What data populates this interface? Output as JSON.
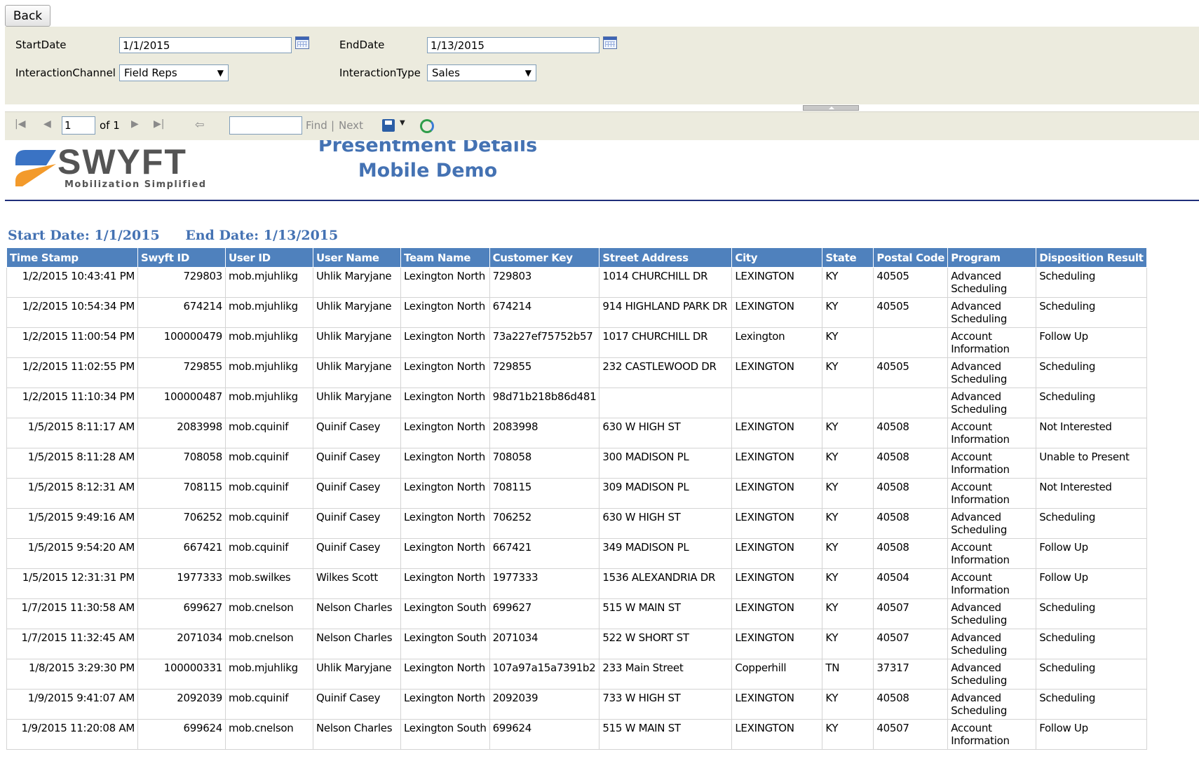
{
  "back_label": "Back",
  "params": {
    "start_date_label": "StartDate",
    "start_date_value": "1/1/2015",
    "end_date_label": "EndDate",
    "end_date_value": "1/13/2015",
    "channel_label": "InteractionChannel",
    "channel_value": "Field Reps",
    "type_label": "InteractionType",
    "type_value": "Sales"
  },
  "toolbar": {
    "page_value": "1",
    "of_label": "of 1",
    "find_label": "Find",
    "separator": "|",
    "next_label": "Next"
  },
  "logo": {
    "name": "SWYFT",
    "tagline": "Mobilization Simplified"
  },
  "report": {
    "title": "Presentment Details",
    "subtitle": "Mobile Demo",
    "start_date_text": "Start Date: 1/1/2015",
    "end_date_text": "End Date: 1/13/2015"
  },
  "table": {
    "columns": [
      "Time Stamp",
      "Swyft ID",
      "User ID",
      "User Name",
      "Team Name",
      "Customer Key",
      "Street Address",
      "City",
      "State",
      "Postal Code",
      "Program",
      "Disposition Result"
    ],
    "rows": [
      [
        "1/2/2015 10:43:41 PM",
        "729803",
        "mob.mjuhlikg",
        "Uhlik Maryjane",
        "Lexington North",
        "729803",
        "1014 CHURCHILL DR",
        "LEXINGTON",
        "KY",
        "40505",
        "Advanced Scheduling",
        "Scheduling"
      ],
      [
        "1/2/2015 10:54:34 PM",
        "674214",
        "mob.mjuhlikg",
        "Uhlik Maryjane",
        "Lexington North",
        "674214",
        "914 HIGHLAND PARK DR",
        "LEXINGTON",
        "KY",
        "40505",
        "Advanced Scheduling",
        "Scheduling"
      ],
      [
        "1/2/2015 11:00:54 PM",
        "100000479",
        "mob.mjuhlikg",
        "Uhlik Maryjane",
        "Lexington North",
        "73a227ef75752b57",
        "1017 CHURCHILL DR",
        "Lexington",
        "KY",
        "",
        "Account Information",
        "Follow Up"
      ],
      [
        "1/2/2015 11:02:55 PM",
        "729855",
        "mob.mjuhlikg",
        "Uhlik Maryjane",
        "Lexington North",
        "729855",
        "232 CASTLEWOOD DR",
        "LEXINGTON",
        "KY",
        "40505",
        "Advanced Scheduling",
        "Scheduling"
      ],
      [
        "1/2/2015 11:10:34 PM",
        "100000487",
        "mob.mjuhlikg",
        "Uhlik Maryjane",
        "Lexington North",
        "98d71b218b86d481",
        "",
        "",
        "",
        "",
        "Advanced Scheduling",
        "Scheduling"
      ],
      [
        "1/5/2015 8:11:17 AM",
        "2083998",
        "mob.cquinif",
        "Quinif Casey",
        "Lexington North",
        "2083998",
        "630 W HIGH ST",
        "LEXINGTON",
        "KY",
        "40508",
        "Account Information",
        "Not Interested"
      ],
      [
        "1/5/2015 8:11:28 AM",
        "708058",
        "mob.cquinif",
        "Quinif Casey",
        "Lexington North",
        "708058",
        "300 MADISON PL",
        "LEXINGTON",
        "KY",
        "40508",
        "Account Information",
        "Unable to Present"
      ],
      [
        "1/5/2015 8:12:31 AM",
        "708115",
        "mob.cquinif",
        "Quinif Casey",
        "Lexington North",
        "708115",
        "309 MADISON PL",
        "LEXINGTON",
        "KY",
        "40508",
        "Account Information",
        "Not Interested"
      ],
      [
        "1/5/2015 9:49:16 AM",
        "706252",
        "mob.cquinif",
        "Quinif Casey",
        "Lexington North",
        "706252",
        "630 W HIGH ST",
        "LEXINGTON",
        "KY",
        "40508",
        "Advanced Scheduling",
        "Scheduling"
      ],
      [
        "1/5/2015 9:54:20 AM",
        "667421",
        "mob.cquinif",
        "Quinif Casey",
        "Lexington North",
        "667421",
        "349 MADISON PL",
        "LEXINGTON",
        "KY",
        "40508",
        "Account Information",
        "Follow Up"
      ],
      [
        "1/5/2015 12:31:31 PM",
        "1977333",
        "mob.swilkes",
        "Wilkes Scott",
        "Lexington North",
        "1977333",
        "1536 ALEXANDRIA DR",
        "LEXINGTON",
        "KY",
        "40504",
        "Account Information",
        "Follow Up"
      ],
      [
        "1/7/2015 11:30:58 AM",
        "699627",
        "mob.cnelson",
        "Nelson Charles",
        "Lexington South",
        "699627",
        "515 W MAIN ST",
        "LEXINGTON",
        "KY",
        "40507",
        "Advanced Scheduling",
        "Scheduling"
      ],
      [
        "1/7/2015 11:32:45 AM",
        "2071034",
        "mob.cnelson",
        "Nelson Charles",
        "Lexington South",
        "2071034",
        "522 W SHORT ST",
        "LEXINGTON",
        "KY",
        "40507",
        "Advanced Scheduling",
        "Scheduling"
      ],
      [
        "1/8/2015 3:29:30 PM",
        "100000331",
        "mob.mjuhlikg",
        "Uhlik Maryjane",
        "Lexington North",
        "107a97a15a7391b2",
        "233 Main Street",
        "Copperhill",
        "TN",
        "37317",
        "Advanced Scheduling",
        "Scheduling"
      ],
      [
        "1/9/2015 9:41:07 AM",
        "2092039",
        "mob.cquinif",
        "Quinif Casey",
        "Lexington North",
        "2092039",
        "733 W HIGH ST",
        "LEXINGTON",
        "KY",
        "40508",
        "Advanced Scheduling",
        "Scheduling"
      ],
      [
        "1/9/2015 11:20:08 AM",
        "699624",
        "mob.cnelson",
        "Nelson Charles",
        "Lexington South",
        "699624",
        "515 W MAIN ST",
        "LEXINGTON",
        "KY",
        "40507",
        "Account Information",
        "Follow Up"
      ]
    ]
  },
  "colors": {
    "header_bg": "#4f81bd",
    "title_blue": "#4472b3",
    "param_bg": "#ecebde",
    "logo_orange": "#f39a2b",
    "logo_blue": "#3a73c4"
  },
  "icons": [
    "calendar-icon",
    "first-page-icon",
    "prev-page-icon",
    "next-page-icon",
    "last-page-icon",
    "back-history-icon",
    "save-icon",
    "refresh-icon"
  ]
}
